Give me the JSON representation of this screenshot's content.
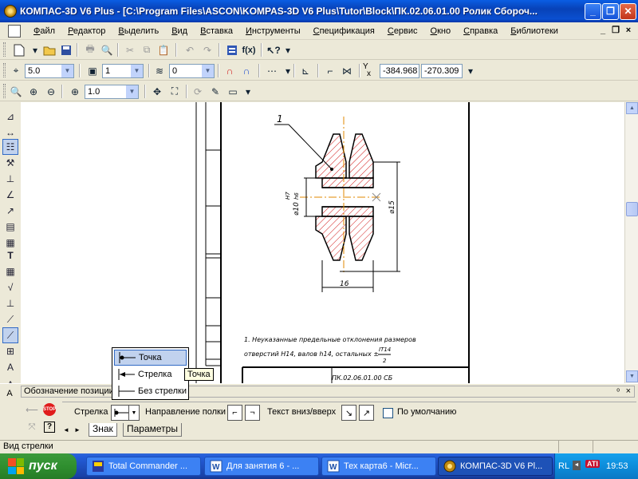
{
  "window": {
    "title": "КОМПАС-3D V6 Plus - [C:\\Program Files\\ASCON\\KOMPAS-3D V6 Plus\\Tutor\\Block\\ПК.02.06.01.00 Ролик Сбороч...",
    "minimize": "_",
    "maximize": "❐",
    "close": "✕"
  },
  "menu": {
    "items": [
      "Файл",
      "Редактор",
      "Выделить",
      "Вид",
      "Вставка",
      "Инструменты",
      "Спецификация",
      "Сервис",
      "Окно",
      "Справка",
      "Библиотеки"
    ],
    "mdi_min": "_",
    "mdi_restore": "❐",
    "mdi_close": "×"
  },
  "toolbar2": {
    "step": "5.0",
    "layer": "1",
    "angle": "0",
    "coord_label_y": "Y",
    "coord_label_x": "x",
    "coord_x": "-384.968",
    "coord_y": "-270.309"
  },
  "toolbar3": {
    "zoom": "1.0"
  },
  "drawing": {
    "callout_number": "1",
    "bore_dim": "⌀10",
    "bore_fit_num": "H7",
    "bore_fit_den": "h6",
    "outer_dim": "⌀15",
    "width_dim": "16",
    "note_line1": "1. Неуказанные предельные отклонения размеров",
    "note_line2_a": "отверстий H14, валов h14, остальных ±",
    "note_frac_num": "IT14",
    "note_frac_den": "2",
    "title_fragment": "ПК.02.06.01.00 СБ"
  },
  "dropdown": {
    "items": [
      "Точка",
      "Стрелка",
      "Без стрелки"
    ],
    "selected": "Точка"
  },
  "tooltip": "Точка",
  "property_panel": {
    "header": "Обозначение позиции",
    "pin": "ᵒ",
    "close": "×",
    "stop": "STOP",
    "help": "?",
    "arrow_label": "Стрелка",
    "shelf_dir_label": "Направление полки",
    "text_dir_label": "Текст вниз/вверх",
    "default_label": "По умолчанию",
    "tabs": [
      "Знак",
      "Параметры"
    ]
  },
  "status": {
    "text": "Вид стрелки"
  },
  "taskbar": {
    "start": "пуск",
    "tasks": [
      "Total Commander ...",
      "Для занятия 6 - ...",
      "Тех карта6 - Micr...",
      "КОМПАС-3D V6 Pl..."
    ],
    "active_index": 3,
    "lang": "RL",
    "ati": "ATI",
    "clock": "19:53"
  },
  "colors": {
    "title_blue": "#0a4fd0",
    "start_green": "#2f8f2f",
    "task_blue": "#3c81f3",
    "hatch_red": "#d21e1e",
    "centerline_orange": "#e08a00",
    "selection_blue": "#c1d2ee"
  },
  "icons": {
    "new": "new-file-icon",
    "open": "open-folder-icon",
    "save": "save-icon",
    "print": "print-icon",
    "zoom_in": "zoom-in-icon",
    "zoom_out": "zoom-out-icon",
    "stop": "stop-icon",
    "help": "help-icon"
  }
}
